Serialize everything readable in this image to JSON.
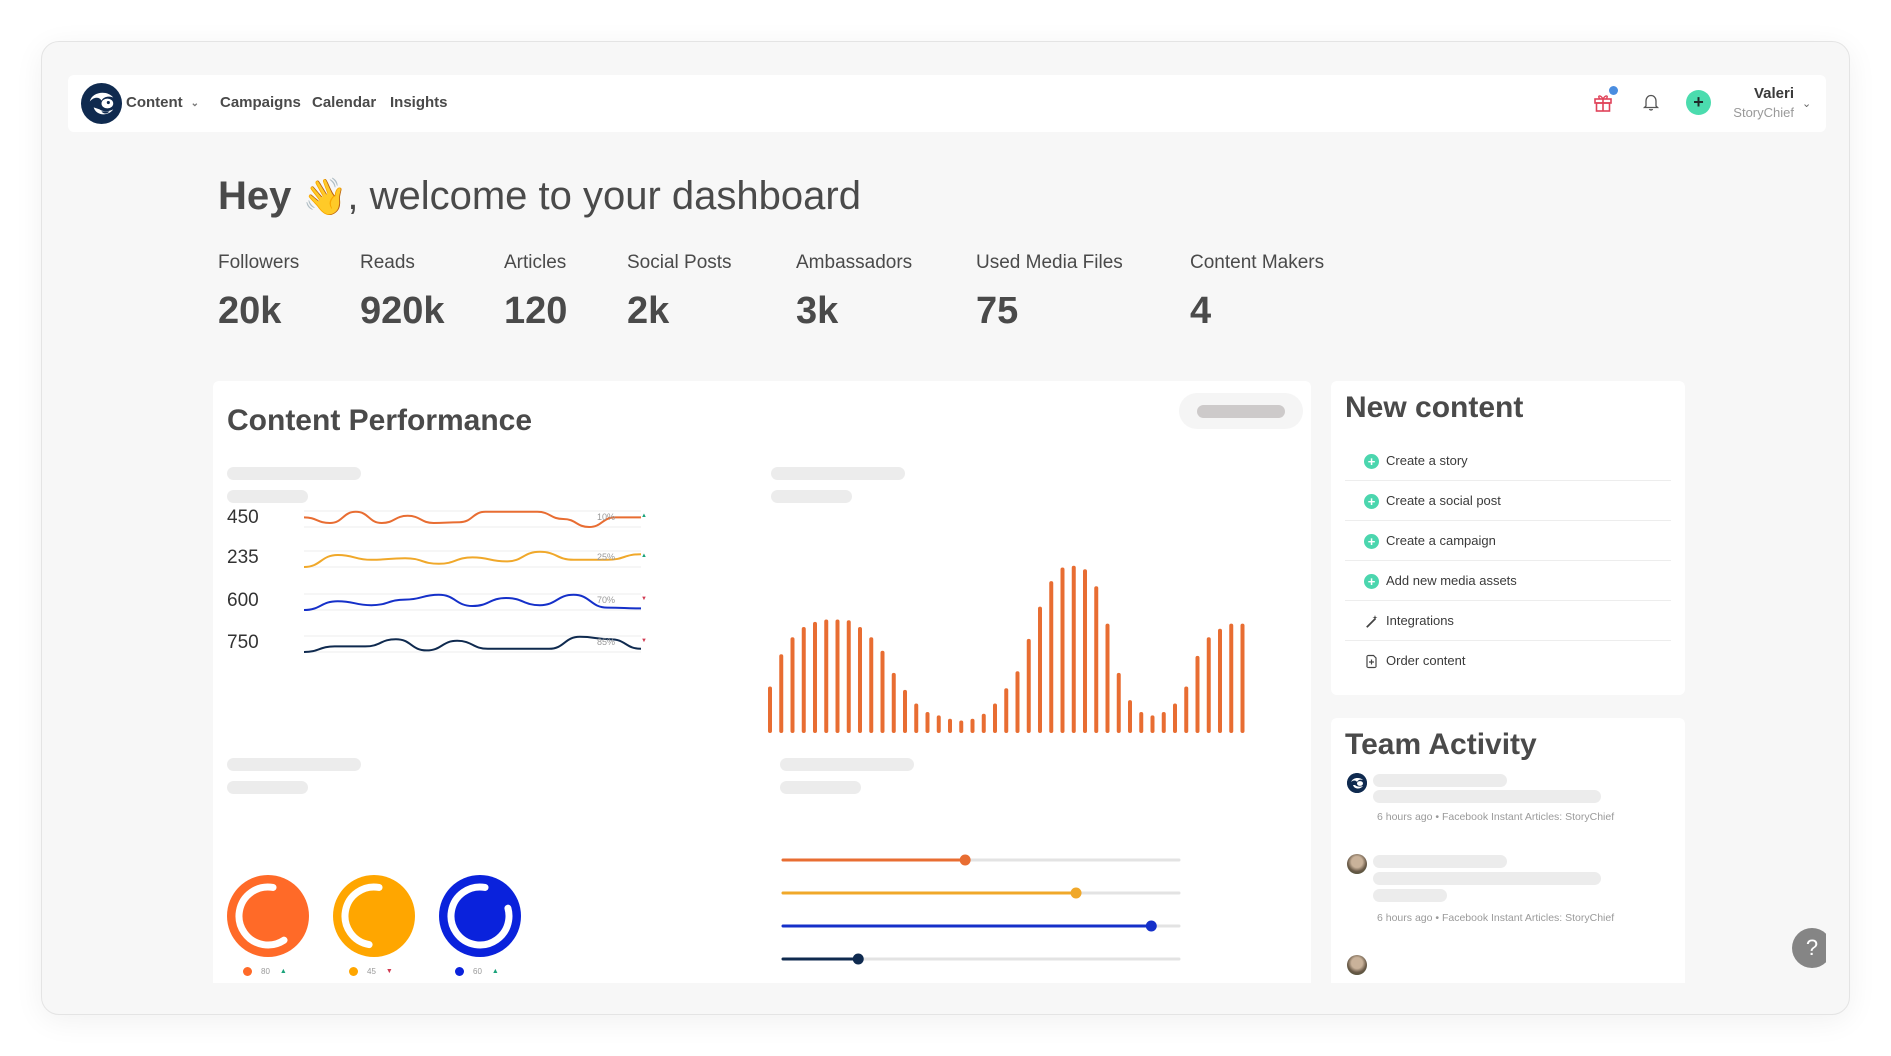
{
  "nav": {
    "items": [
      {
        "label": "Content",
        "has_dropdown": true
      },
      {
        "label": "Campaigns"
      },
      {
        "label": "Calendar"
      },
      {
        "label": "Insights"
      }
    ],
    "user": {
      "name": "Valeri",
      "org": "StoryChief"
    },
    "icons": {
      "gift": "gift-icon",
      "bell": "bell-icon",
      "add": "plus-icon"
    },
    "plus_glyph": "+",
    "chevron_glyph": "⌄"
  },
  "welcome": {
    "bold": "Hey",
    "emoji": "👋",
    "rest": ", welcome to your dashboard"
  },
  "stats": [
    {
      "label": "Followers",
      "value": "20k"
    },
    {
      "label": "Reads",
      "value": "920k"
    },
    {
      "label": "Articles",
      "value": "120"
    },
    {
      "label": "Social Posts",
      "value": "2k"
    },
    {
      "label": "Ambassadors",
      "value": "3k"
    },
    {
      "label": "Used Media Files",
      "value": "75"
    },
    {
      "label": "Content Makers",
      "value": "4"
    }
  ],
  "content_performance": {
    "title": "Content Performance"
  },
  "colors": {
    "orange": "#e86d32",
    "yellow": "#f0a82a",
    "blue": "#1530c9",
    "navy": "#0f2a4f",
    "teal": "#4bd6ae",
    "up": "#1aa37a",
    "down": "#d13b52",
    "donut_orange": "#ff6a28",
    "donut_yellow": "#ffa600",
    "donut_blue": "#0a22dc"
  },
  "chart_data": [
    {
      "type": "line",
      "title": "",
      "series": [
        {
          "name": "450",
          "total": "450",
          "change": "10%",
          "trend": "up",
          "color": "#e86d32",
          "values": [
            0.6,
            0.25,
            0.95,
            0.25,
            0.7,
            0.25,
            0.3,
            0.95,
            0.95,
            0.95,
            0.5,
            0.0,
            0.6,
            0.6
          ]
        },
        {
          "name": "235",
          "total": "235",
          "change": "25%",
          "trend": "up",
          "color": "#f0a82a",
          "values": [
            0.0,
            0.75,
            0.45,
            0.55,
            0.2,
            0.6,
            0.35,
            0.95,
            0.45,
            0.45,
            0.8
          ]
        },
        {
          "name": "600",
          "total": "600",
          "change": "70%",
          "trend": "down",
          "color": "#1530c9",
          "values": [
            0.0,
            0.55,
            0.3,
            0.65,
            0.95,
            0.25,
            0.75,
            0.3,
            0.95,
            0.15,
            0.1
          ]
        },
        {
          "name": "750",
          "total": "750",
          "change": "85%",
          "trend": "down",
          "color": "#0f2a4f",
          "values": [
            0.0,
            0.35,
            0.35,
            0.8,
            0.1,
            0.7,
            0.2,
            0.2,
            0.2,
            0.95,
            0.8,
            0.2
          ]
        }
      ]
    },
    {
      "type": "bar",
      "title": "",
      "color": "#e86d32",
      "values": [
        125,
        220,
        270,
        300,
        315,
        322,
        322,
        320,
        300,
        270,
        230,
        165,
        115,
        75,
        50,
        40,
        30,
        25,
        30,
        45,
        75,
        120,
        170,
        265,
        360,
        435,
        475,
        480,
        470,
        420,
        310,
        165,
        85,
        50,
        40,
        50,
        75,
        125,
        215,
        270,
        295,
        310,
        310
      ],
      "ylim": [
        0,
        500
      ]
    },
    {
      "type": "pie",
      "title": "",
      "donuts": [
        {
          "value": 80,
          "trend": "up",
          "color": "#ff6a28",
          "fill_fraction": 0.62
        },
        {
          "value": 45,
          "trend": "down",
          "color": "#ffa600",
          "fill_fraction": 0.5
        },
        {
          "value": 60,
          "trend": "up",
          "color": "#0a22dc",
          "fill_fraction": 0.82
        }
      ]
    },
    {
      "type": "bar",
      "title": "",
      "orientation": "horizontal-slider",
      "sliders": [
        {
          "color": "#e86d32",
          "fraction": 0.46
        },
        {
          "color": "#f0a82a",
          "fraction": 0.74
        },
        {
          "color": "#1530c9",
          "fraction": 0.93
        },
        {
          "color": "#0f2a4f",
          "fraction": 0.19
        }
      ]
    }
  ],
  "new_content": {
    "title": "New content",
    "items": [
      {
        "label": "Create a story",
        "icon": "plus-circle-icon"
      },
      {
        "label": "Create a social post",
        "icon": "plus-circle-icon"
      },
      {
        "label": "Create a campaign",
        "icon": "plus-circle-icon"
      },
      {
        "label": "Add new media assets",
        "icon": "plus-circle-icon"
      },
      {
        "label": "Integrations",
        "icon": "magic-wand-icon"
      },
      {
        "label": "Order content",
        "icon": "document-plus-icon"
      }
    ]
  },
  "team_activity": {
    "title": "Team Activity",
    "entries": [
      {
        "avatar": "brand",
        "meta": "6 hours ago • Facebook Instant Articles: StoryChief"
      },
      {
        "avatar": "person",
        "meta": "6 hours ago • Facebook Instant Articles: StoryChief"
      },
      {
        "avatar": "person",
        "meta": ""
      }
    ]
  },
  "help": {
    "label": "?"
  }
}
